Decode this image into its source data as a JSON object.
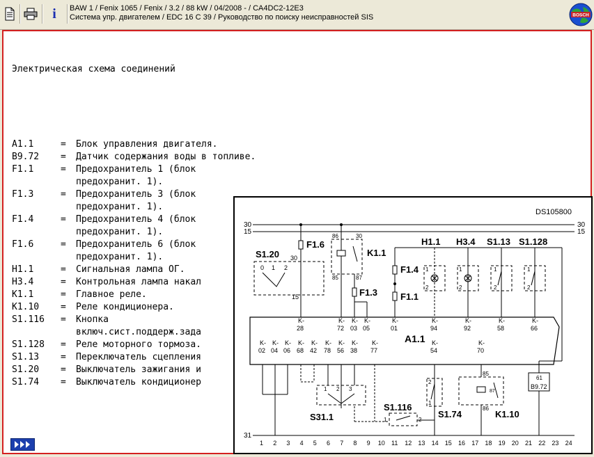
{
  "window": {
    "title_line1": "BAW 1 / Fenix 1065 / Fenix / 3.2 / 88 kW / 04/2008 -  / CA4DC2-12E3",
    "title_line2": "Система упр. двигателем / EDC 16 C 39 / Руководство по поиску неисправностей SIS"
  },
  "toolbar": {
    "icons": [
      "document-icon",
      "print-icon",
      "info-icon"
    ],
    "info_label": "i"
  },
  "logo": {
    "text": "BOSCH",
    "icon": "bosch-globe-icon"
  },
  "doc": {
    "heading": "Электрическая схема соединений",
    "legend": [
      {
        "code": "A1.1",
        "desc": "Блок управления двигателя.",
        "cont": ""
      },
      {
        "code": "B9.72",
        "desc": "Датчик содержания воды в топливе.",
        "cont": ""
      },
      {
        "code": "F1.1",
        "desc": "Предохранитель 1 (блок",
        "cont": "предохранит. 1)."
      },
      {
        "code": "F1.3",
        "desc": "Предохранитель 3 (блок",
        "cont": "предохранит. 1)."
      },
      {
        "code": "F1.4",
        "desc": "Предохранитель 4 (блок",
        "cont": "предохранит. 1)."
      },
      {
        "code": "F1.6",
        "desc": "Предохранитель 6 (блок",
        "cont": "предохранит. 1)."
      },
      {
        "code": "H1.1",
        "desc": "Сигнальная лампа ОГ.",
        "cont": ""
      },
      {
        "code": "H3.4",
        "desc": "Контрольная лампа накал",
        "cont": ""
      },
      {
        "code": "K1.1",
        "desc": "Главное реле.",
        "cont": ""
      },
      {
        "code": "K1.10",
        "desc": "Реле кондиционера.",
        "cont": ""
      },
      {
        "code": "S1.116",
        "desc": "Кнопка",
        "cont": "включ.сист.поддерж.зада"
      },
      {
        "code": "S1.128",
        "desc": "Реле моторного тормоза.",
        "cont": ""
      },
      {
        "code": "S1.13",
        "desc": "Переключатель сцепления",
        "cont": ""
      },
      {
        "code": "S1.20",
        "desc": "Выключатель зажигания и",
        "cont": ""
      },
      {
        "code": "S1.74",
        "desc": "Выключатель кондиционер",
        "cont": ""
      }
    ],
    "eq": "="
  },
  "diagram": {
    "id": "DS105800",
    "rail_30": "30",
    "rail_15": "15",
    "rail_31": "31",
    "components": {
      "S1.20": "S1.20",
      "F1.6": "F1.6",
      "K1.1": "K1.1",
      "F1.3": "F1.3",
      "F1.4": "F1.4",
      "F1.1": "F1.1",
      "H1.1": "H1.1",
      "H3.4": "H3.4",
      "S1.13": "S1.13",
      "S1.128": "S1.128",
      "A1.1": "A1.1",
      "S31.1": "S31.1",
      "S1.116": "S1.116",
      "S1.74": "S1.74",
      "K1.10": "K1.10",
      "B9.72": "B9.72"
    },
    "top_pins": [
      "K-\n28",
      "K-\n72",
      "K-\n03",
      "K-\n05",
      "K-\n01",
      "K-\n94",
      "K-\n92",
      "K-\n58",
      "K-\n66"
    ],
    "bottom_pins": [
      "K-\n02",
      "K-\n04",
      "K-\n06",
      "K-\n68",
      "K-\n42",
      "K-\n78",
      "K-\n56",
      "K-\n38",
      "K-\n77",
      "K-\n54",
      "K-\n70"
    ],
    "ground_numbers": [
      "1",
      "2",
      "3",
      "4",
      "5",
      "6",
      "7",
      "8",
      "9",
      "10",
      "11",
      "12",
      "13",
      "14",
      "15",
      "16",
      "17",
      "18",
      "19",
      "20",
      "21",
      "22",
      "23",
      "24"
    ],
    "small_labels": {
      "sw_0": "0",
      "sw_1": "1",
      "sw_2": "2",
      "sw_30": "30",
      "sw_15": "15",
      "k11_86": "86",
      "k11_30": "30",
      "k11_85": "85",
      "k11_87": "87",
      "k110_85": "85",
      "k110_86": "86",
      "k110_30": "30",
      "k110_87": "87",
      "b972_61": "61",
      "s311_1": "1",
      "s311_2": "2",
      "s311_3": "3",
      "s1116_1": "1",
      "s1116_2": "2",
      "s174_2": "2",
      "s174_1": "1",
      "h11_1": "1",
      "h11_2": "2",
      "h34_1": "1",
      "h34_2": "2",
      "s113_1": "1",
      "s113_2": "2",
      "s1128_1": "1",
      "s1128_2": "2"
    }
  },
  "nav": {
    "icon": "fast-forward-icon"
  }
}
